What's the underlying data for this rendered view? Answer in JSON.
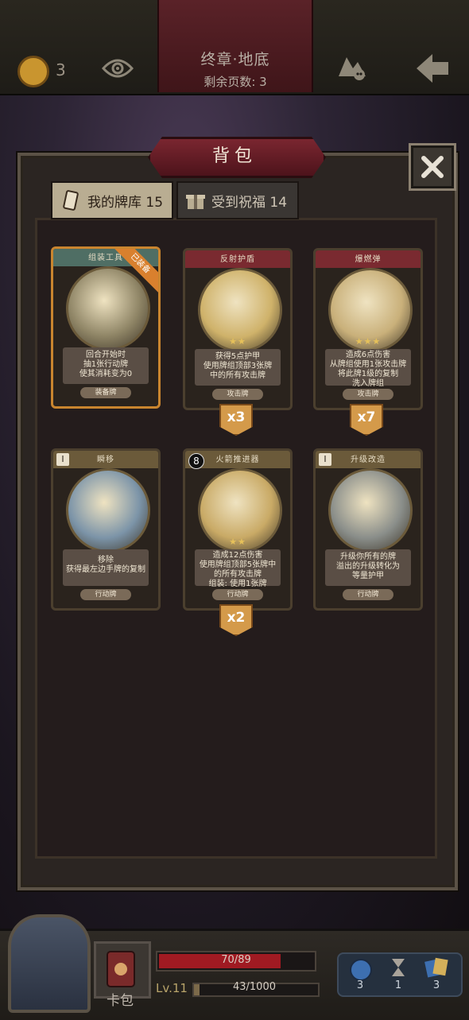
{
  "top_bar": {
    "coin_count": "3",
    "chapter_title": "终章·地底",
    "pages_left": "剩余页数: 3"
  },
  "backpack": {
    "title": "背包",
    "tabs": [
      {
        "label": "我的牌库 15",
        "selected": true
      },
      {
        "label": "受到祝福 14",
        "selected": false
      }
    ]
  },
  "cards": [
    {
      "name": "组装工具",
      "badge": "已装备",
      "stars": "",
      "desc": [
        "回合开始时",
        "抽1张行动牌",
        "使其消耗变为0"
      ],
      "type": "装备牌",
      "count": "",
      "cost": ""
    },
    {
      "name": "反射护盾",
      "badge": "",
      "stars": "★★",
      "desc": [
        "获得5点护甲",
        "使用牌组顶部3张牌",
        "中的所有攻击牌"
      ],
      "type": "攻击牌",
      "count": "x3",
      "cost": ""
    },
    {
      "name": "爆燃弹",
      "badge": "",
      "stars": "★★★",
      "desc": [
        "造成6点伤害",
        "从牌组使用1张攻击牌",
        "将此牌1级的复制",
        "洗入牌组"
      ],
      "type": "攻击牌",
      "count": "x7",
      "cost": ""
    },
    {
      "name": "瞬移",
      "badge": "",
      "stars": "",
      "desc": [
        "移除",
        "获得最左边手牌的复制"
      ],
      "type": "行动牌",
      "count": "",
      "cost": "I"
    },
    {
      "name": "火箭推进器",
      "badge": "",
      "stars": "★★",
      "desc": [
        "造成12点伤害",
        "使用牌组顶部5张牌中",
        "的所有攻击牌",
        "组装: 使用1张牌"
      ],
      "type": "行动牌",
      "count": "x2",
      "cost": "8"
    },
    {
      "name": "升级改造",
      "badge": "",
      "stars": "",
      "desc": [
        "升级你所有的牌",
        "溢出的升级转化为",
        "等量护甲"
      ],
      "type": "行动牌",
      "count": "",
      "cost": "I"
    }
  ],
  "status": {
    "hp_text": "70/89",
    "hp_ratio": 0.787,
    "level": "Lv.11",
    "xp_text": "43/1000",
    "xp_ratio": 0.043,
    "card_pack_label": "卡包",
    "resources": [
      "3",
      "1",
      "3"
    ]
  },
  "colors": {
    "hp": "#a01a22",
    "accent": "#d49a4a",
    "banner": "#7a2630"
  },
  "icons": [
    "crown-coin-icon",
    "eye-icon",
    "skull-scroll-icon",
    "back-arrow-icon",
    "close-icon",
    "card-deck-icon",
    "gift-icon",
    "gear-door-icon",
    "card-pack-icon",
    "bomb-icon",
    "hourglass-icon",
    "cards-icon"
  ]
}
